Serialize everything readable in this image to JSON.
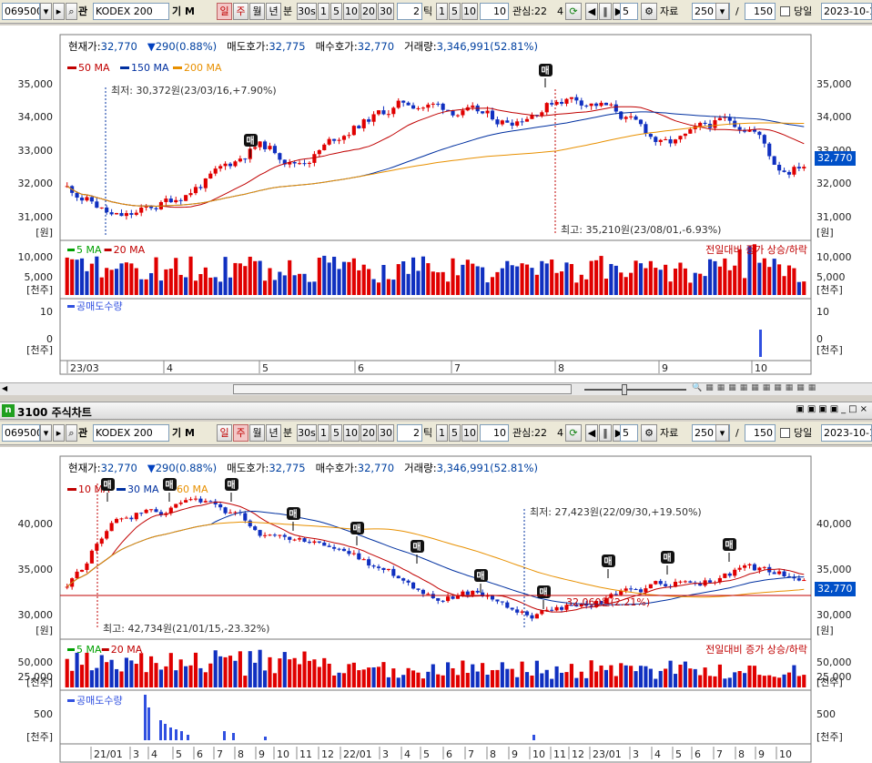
{
  "toolbar": {
    "code": "069500",
    "name": "KODEX 200",
    "gi_label": "기",
    "m_label": "M",
    "gwan_label": "관",
    "periods": [
      "일",
      "주",
      "월",
      "년"
    ],
    "bun_label": "분",
    "minute_tabs": [
      "30s",
      "1",
      "5",
      "10",
      "20",
      "30"
    ],
    "tick_value": "2",
    "tick_label": "틱",
    "tick_tabs": [
      "1",
      "5",
      "10"
    ],
    "tick_count": "10",
    "interest_label": "관심:22",
    "interest_value": "4",
    "step_value": "5",
    "data_label": "자료",
    "data_count": "250",
    "slash": "/",
    "data_total": "150",
    "today_label": "당일",
    "date_value": "2023-10-1"
  },
  "chart1": {
    "header": {
      "cur_label": "현재가:",
      "cur": "32,770",
      "change": "290(0.88%)",
      "ask_label": "매도호가:",
      "ask": "32,775",
      "bid_label": "매수호가:",
      "bid": "32,770",
      "vol_label": "거래량:",
      "vol": "3,346,991(52.81%)"
    },
    "legend": [
      {
        "label": "50 MA",
        "color": "#c00000"
      },
      {
        "label": "150 MA",
        "color": "#0030a0"
      },
      {
        "label": "200 MA",
        "color": "#e89000"
      }
    ],
    "price_ticks": [
      "35,000",
      "34,000",
      "33,000",
      "32,000",
      "31,000"
    ],
    "price_unit": "[원]",
    "low_annot": "최저: 30,372원(23/03/16,+7.90%)",
    "high_annot": "최고: 35,210원(23/08/01,-6.93%)",
    "buy_marker": "매",
    "current_price": "32,770",
    "vol_legend": [
      {
        "label": "5 MA",
        "color": "#00a000"
      },
      {
        "label": "20 MA",
        "color": "#c00000"
      }
    ],
    "vol_note": "전일대비 증가 상승/하락",
    "vol_ticks": [
      "10,000",
      "5,000"
    ],
    "vol_unit": "[천주]",
    "short_label": "공매도수량",
    "short_ticks": [
      "10",
      "0"
    ],
    "short_unit": "[천주]",
    "x_labels": [
      "23/03",
      "4",
      "5",
      "6",
      "7",
      "8",
      "9",
      "10"
    ]
  },
  "window2": {
    "title": "3100 주식차트",
    "badge": "n"
  },
  "chart2": {
    "header": {
      "cur_label": "현재가:",
      "cur": "32,770",
      "change": "290(0.88%)",
      "ask_label": "매도호가:",
      "ask": "32,775",
      "bid_label": "매수호가:",
      "bid": "32,770",
      "vol_label": "거래량:",
      "vol": "3,346,991(52.81%)"
    },
    "legend": [
      {
        "label": "10 MA",
        "color": "#c00000"
      },
      {
        "label": "30 MA",
        "color": "#0030a0"
      },
      {
        "label": "60 MA",
        "color": "#e89000"
      }
    ],
    "price_ticks": [
      "40,000",
      "35,000",
      "30,000"
    ],
    "price_unit": "[원]",
    "low_annot": "최저: 27,423원(22/09/30,+19.50%)",
    "high_annot": "최고: 42,734원(21/01/15,-23.32%)",
    "mid_annot": "32,060원(2.21%)",
    "current_price": "32,770",
    "vol_legend": [
      {
        "label": "5 MA",
        "color": "#00a000"
      },
      {
        "label": "20 MA",
        "color": "#c00000"
      }
    ],
    "vol_note": "전일대비 증가 상승/하락",
    "vol_ticks": [
      "50,000",
      "25,000"
    ],
    "vol_unit": "[천주]",
    "short_label": "공매도수량",
    "short_ticks": [
      "500"
    ],
    "short_unit": "[천주]",
    "x_labels": [
      "21/01",
      "3",
      "4",
      "5",
      "6",
      "7",
      "8",
      "9",
      "10",
      "11",
      "12",
      "22/01",
      "3",
      "4",
      "5",
      "6",
      "7",
      "8",
      "9",
      "10",
      "11",
      "12",
      "23/01",
      "3",
      "4",
      "5",
      "6",
      "7",
      "8",
      "9",
      "10"
    ]
  },
  "colors": {
    "up": "#e00000",
    "down": "#1030c0",
    "bg": "#ffffff"
  }
}
